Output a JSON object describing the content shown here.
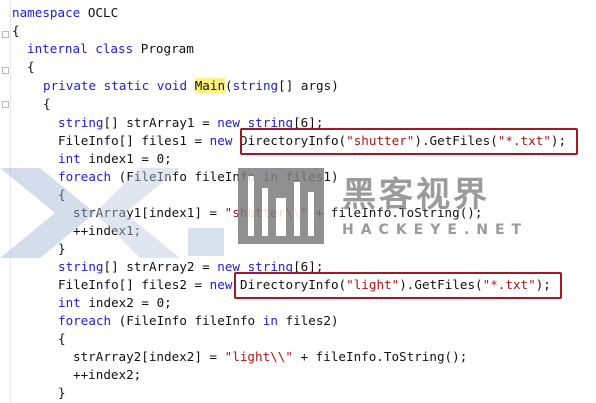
{
  "code": {
    "l1_kw": "namespace",
    "l1_name": " OCLC",
    "l2": "{",
    "l3_kw1": "internal",
    "l3_kw2": "class",
    "l3_name": " Program",
    "l4": "{",
    "l5_kw1": "private",
    "l5_kw2": "static",
    "l5_kw3": "void",
    "l5_method": "Main",
    "l5_p1": "(",
    "l5_type": "string",
    "l5_p2": "[] args)",
    "l6": "{",
    "l7_type": "string",
    "l7_a": "[] strArray1 = ",
    "l7_kw": "new",
    "l7_type2": "string",
    "l7_b": "[6];",
    "l8_a": "FileInfo[] files1 = ",
    "l8_kw": "new",
    "l8_b": " DirectoryInfo(",
    "l8_s1": "\"shutter\"",
    "l8_c": ").GetFiles(",
    "l8_s2": "\"*.txt\"",
    "l8_d": ");",
    "l9_type": "int",
    "l9_a": " index1 = 0;",
    "l10_kw": "foreach",
    "l10_a": " (FileInfo fileInfo ",
    "l10_kw2": "in",
    "l10_b": " files1)",
    "l11": "{",
    "l12_a": "strArray1[index1] = ",
    "l12_s": "\"shutter\\\\\"",
    "l12_b": " + fileInfo.ToString();",
    "l13": "++index1;",
    "l14": "}",
    "l15_type": "string",
    "l15_a": "[] strArray2 = ",
    "l15_kw": "new",
    "l15_type2": "string",
    "l15_b": "[6];",
    "l16_a": "FileInfo[] files2 = ",
    "l16_kw": "new",
    "l16_b": " DirectoryInfo(",
    "l16_s1": "\"light\"",
    "l16_c": ").GetFiles(",
    "l16_s2": "\"*.txt\"",
    "l16_d": ");",
    "l17_type": "int",
    "l17_a": " index2 = 0;",
    "l18_kw": "foreach",
    "l18_a": " (FileInfo fileInfo ",
    "l18_kw2": "in",
    "l18_b": " files2)",
    "l19": "{",
    "l20_a": "strArray2[index2] = ",
    "l20_s": "\"light\\\\\"",
    "l20_b": " + fileInfo.ToString();",
    "l21": "++index2;",
    "l22": "}"
  },
  "watermark": {
    "cn": "黑客视界",
    "en": "HACKEYE.NET"
  },
  "colors": {
    "keyword": "#2020d8",
    "type": "#1e7fa0",
    "string": "#b01515",
    "highlight_box": "#a01822"
  }
}
